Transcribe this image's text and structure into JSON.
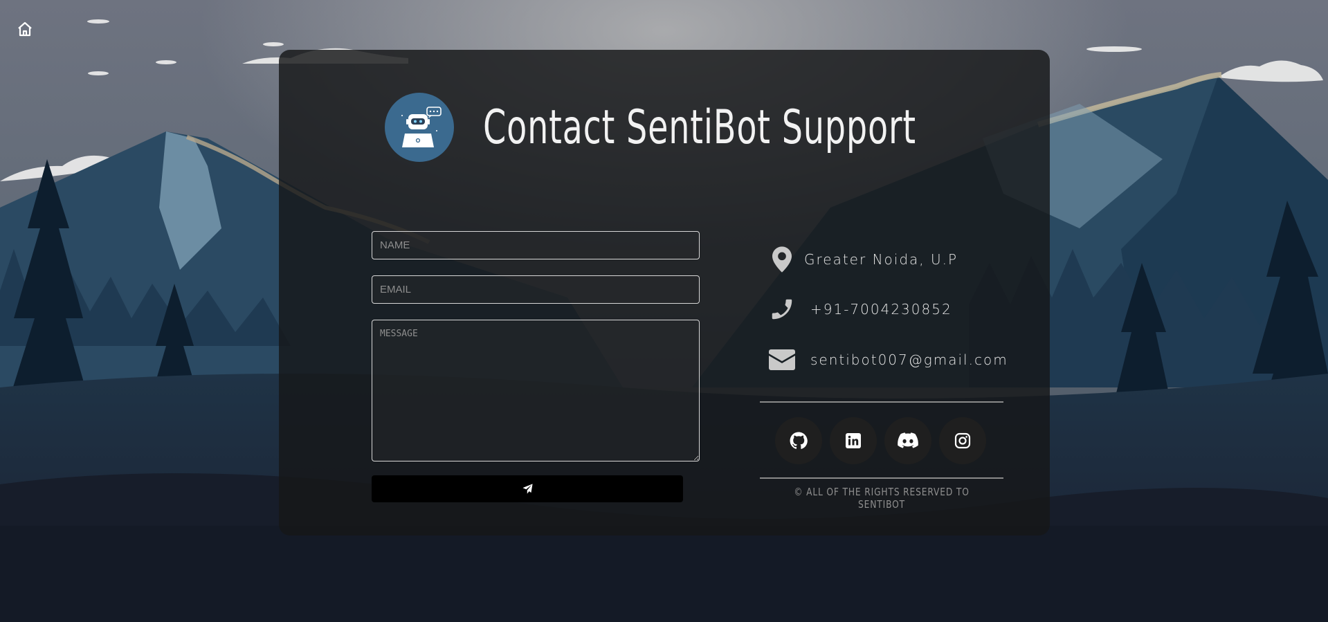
{
  "nav": {
    "home_icon": "home-icon"
  },
  "header": {
    "logo_icon": "robot-laptop-icon",
    "title": "Contact SentiBot Support"
  },
  "form": {
    "name_placeholder": "NAME",
    "email_placeholder": "EMAIL",
    "message_placeholder": "MESSAGE",
    "name_value": "",
    "email_value": "",
    "message_value": "",
    "send_icon": "paper-plane-icon"
  },
  "contact": {
    "location": {
      "icon": "map-pin-icon",
      "text": "Greater Noida, U.P"
    },
    "phone": {
      "icon": "phone-icon",
      "text": "+91-7004230852"
    },
    "email": {
      "icon": "envelope-icon",
      "text": "sentibot007@gmail.com"
    }
  },
  "socials": [
    {
      "icon": "github-icon"
    },
    {
      "icon": "linkedin-icon"
    },
    {
      "icon": "discord-icon"
    },
    {
      "icon": "instagram-icon"
    }
  ],
  "footer": {
    "text": "© ALL OF THE RIGHTS RESERVED TO SENTIBOT"
  },
  "colors": {
    "card_bg": "#161719",
    "logo_bg": "#3b6a8f",
    "text": "#f2f2f2",
    "muted": "#8f8f8f",
    "send_button": "#000000"
  }
}
